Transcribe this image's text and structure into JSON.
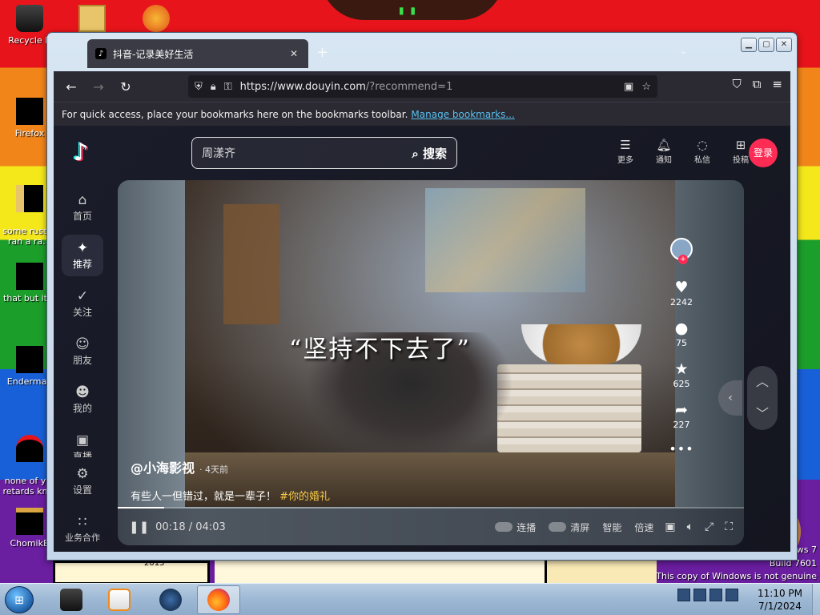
{
  "desktop": {
    "icons": [
      {
        "label": "Recycle B",
        "top": "top"
      },
      {
        "label": "Firefox"
      },
      {
        "label": "some russ…\nran a ra…"
      },
      {
        "label": "that but it…"
      },
      {
        "label": "Enderman"
      },
      {
        "label": "none of y…\nretards kn…"
      },
      {
        "label": "ChomikB"
      }
    ],
    "year_text": "2015",
    "watermark_line1": "ws 7",
    "watermark_line2": "Build 7601",
    "watermark_line3": "This copy of Windows is not genuine",
    "watermark_date": "7/1/2024"
  },
  "browser": {
    "tab_title": "抖音-记录美好生活",
    "tab_close": "✕",
    "new_tab": "+",
    "list_all_tabs": "⌄",
    "url_host": "https://www.douyin.com",
    "url_path": "/?recommend=1",
    "bookmarks_text": "For quick access, place your bookmarks here on the bookmarks toolbar.",
    "bookmarks_link": "Manage bookmarks..."
  },
  "douyin": {
    "search_query": "周漾齐",
    "search_button": "搜索",
    "top_actions": [
      {
        "icon": "menu-icon",
        "glyph": "☰",
        "label": "更多"
      },
      {
        "icon": "bell-icon",
        "glyph": "⍾",
        "label": "通知"
      },
      {
        "icon": "chat-icon",
        "glyph": "⬭",
        "label": "私信"
      },
      {
        "icon": "upload-icon",
        "glyph": "⊞",
        "label": "投稿"
      }
    ],
    "login": "登录",
    "sidebar": [
      {
        "icon": "home-icon",
        "glyph": "⌂",
        "label": "首页"
      },
      {
        "icon": "sparkle-icon",
        "glyph": "✦",
        "label": "推荐"
      },
      {
        "icon": "follow-icon",
        "glyph": "✓",
        "label": "关注"
      },
      {
        "icon": "friends-icon",
        "glyph": "☺",
        "label": "朋友"
      },
      {
        "icon": "profile-icon",
        "glyph": "☻",
        "label": "我的"
      },
      {
        "icon": "live-icon",
        "glyph": "▣",
        "label": "直播"
      },
      {
        "icon": "settings-icon",
        "glyph": "⚙",
        "label": "设置"
      },
      {
        "icon": "business-icon",
        "glyph": "∷",
        "label": "业务合作"
      }
    ],
    "video": {
      "overlay_caption": "“坚持不下去了”",
      "author": "@小海影视",
      "posted": "· 4天前",
      "description": "有些人一但错过，就是一辈子！",
      "hashtag": "#你的婚礼",
      "likes": "2242",
      "comments": "75",
      "favorites": "625",
      "shares": "227",
      "current_time": "00:18",
      "duration": "04:03",
      "progress_fraction": 0.074,
      "controls": {
        "autoplay": "连播",
        "clear_screen": "清屏",
        "smart": "智能",
        "speed": "倍速"
      }
    }
  },
  "taskbar": {
    "time": "11:10 PM",
    "date": "7/1/2024"
  },
  "colors": {
    "douyin_red": "#fe2c55",
    "douyin_bg": "#161823",
    "firefox_toolbar": "#2b2a33",
    "link": "#58c0f0",
    "hashtag": "#f7c948"
  }
}
